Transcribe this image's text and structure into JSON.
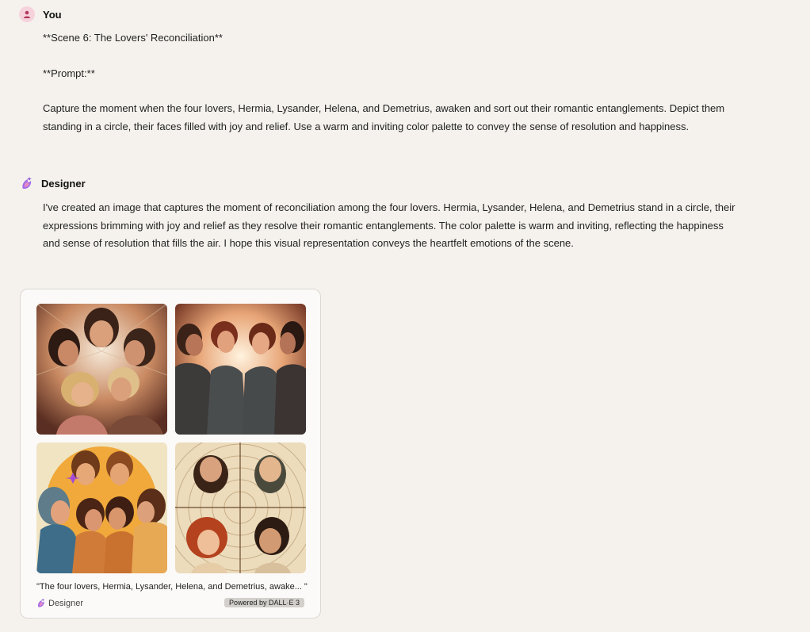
{
  "user_message": {
    "sender": "You",
    "lines": [
      "**Scene 6: The Lovers' Reconciliation**",
      "**Prompt:**",
      "Capture the moment when the four lovers, Hermia, Lysander, Helena, and Demetrius, awaken and sort out their romantic entanglements. Depict them",
      "standing in a circle, their faces filled with joy and relief. Use a warm and inviting color palette to convey the sense of resolution and happiness."
    ]
  },
  "designer_message": {
    "sender": "Designer",
    "lines": [
      "I've created an image that captures the moment of reconciliation among the four lovers. Hermia, Lysander, Helena, and Demetrius stand in a circle, their",
      "expressions brimming with joy and relief as they resolve their romantic entanglements. The color palette is warm and inviting, reflecting the happiness",
      "and sense of resolution that fills the air. I hope this visual representation conveys the heartfelt emotions of the scene."
    ]
  },
  "image_card": {
    "caption": "\"The four lovers, Hermia, Lysander, Helena, and Demetrius, awake... \"",
    "brand_label": "Designer",
    "powered_label": "Powered by DALL·E 3",
    "images": [
      {
        "name": "image-1-lovers-looking-down",
        "icon": "illustration"
      },
      {
        "name": "image-2-lovers-standing",
        "icon": "illustration"
      },
      {
        "name": "image-3-lovers-embracing",
        "icon": "illustration"
      },
      {
        "name": "image-4-lovers-circle-view",
        "icon": "illustration"
      }
    ]
  },
  "colors": {
    "background": "#f5f2ed",
    "user_avatar": "#f6d3dc",
    "designer_accent": "#8a4fd8"
  }
}
